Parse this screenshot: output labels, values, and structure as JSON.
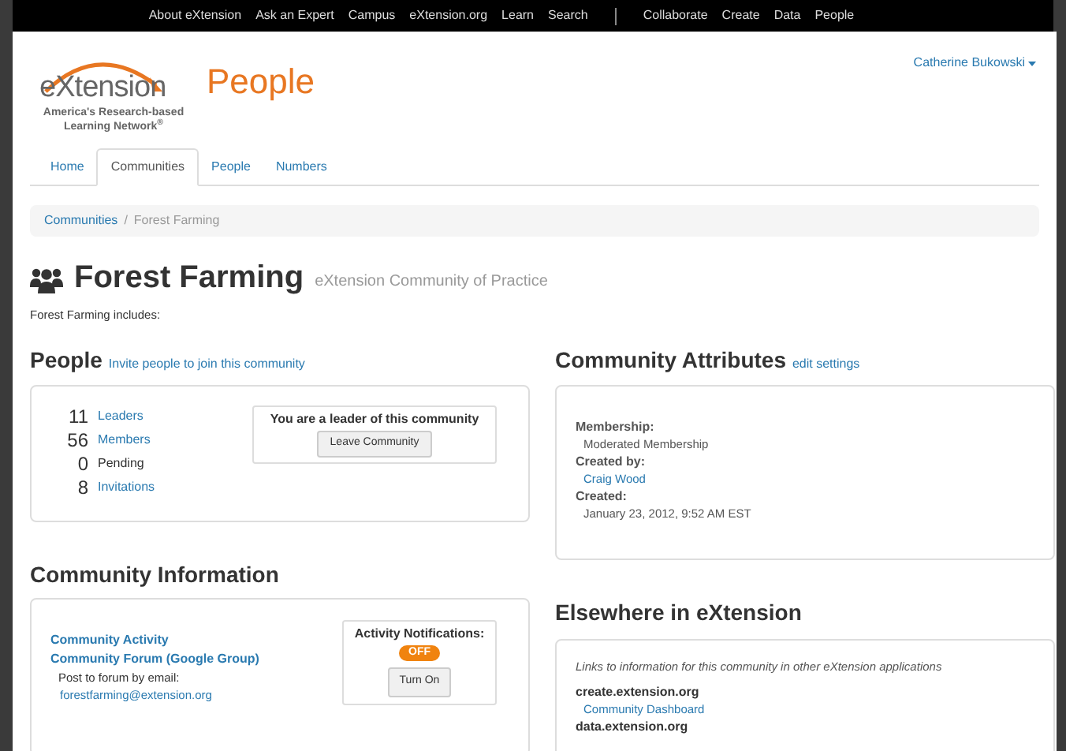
{
  "top_nav": {
    "links": [
      "About eXtension",
      "Ask an Expert",
      "Campus",
      "eXtension.org",
      "Learn",
      "Search"
    ],
    "apps": [
      "Collaborate",
      "Create",
      "Data",
      "People"
    ]
  },
  "logo": {
    "wordmark": "eXtension",
    "tagline": [
      "America's Research-based",
      "Learning Network$^{®}$"
    ],
    "app_name": "People"
  },
  "user_menu": {
    "label": "Catherine Bukowski"
  },
  "tabs": [
    {
      "label": "Home",
      "selected": false
    },
    {
      "label": "Communities",
      "selected": true
    },
    {
      "label": "People",
      "selected": false
    },
    {
      "label": "Numbers",
      "selected": false
    }
  ],
  "breadcrumb": [
    {
      "label": "Communities",
      "link": true
    },
    {
      "separator": "/",
      "label": "Forest Farming",
      "link": false
    }
  ],
  "page": {
    "title": "Forest Farming",
    "subtitle": "eXtension Community of Practice",
    "intro": "Forest Farming includes:"
  },
  "people": {
    "heading": "People",
    "action": "Invite people to join this community",
    "counts": [
      {
        "count": "11",
        "label": "Leaders",
        "link": true
      },
      {
        "count": "56",
        "label": "Members",
        "link": true
      },
      {
        "count": "0",
        "label": "Pending",
        "link": false
      },
      {
        "count": "8",
        "label": "Invitations",
        "link": true
      }
    ],
    "membership_box": {
      "message": "You are a leader of this community",
      "button": "Leave Community"
    }
  },
  "community_information": {
    "heading": "Community Information",
    "links": [
      "Community Activity",
      "Community Forum (Google Group)"
    ],
    "email_label": "Post to forum by email:",
    "email": "forestfarming@extension.org",
    "notifications": {
      "label": "Activity Notifications:",
      "badge": "OFF",
      "on": false,
      "button": "Turn On"
    }
  },
  "community_attributes": {
    "heading": "Community Attributes",
    "action": "edit settings",
    "fields": [
      {
        "label": "Membership:",
        "value": "Moderated Membership",
        "link": false
      },
      {
        "label": "Created by:",
        "value": "Craig Wood",
        "link": true
      },
      {
        "label": "Created:",
        "value": "January 23, 2012, 9:52 AM EST",
        "link": false
      }
    ]
  },
  "elsewhere": {
    "heading": "Elsewhere in eXtension",
    "note": "Links to information for this community in other eXtension applications",
    "sites": [
      {
        "name": "create.extension.org",
        "links": [
          "Community Dashboard"
        ]
      },
      {
        "name": "data.extension.org"
      }
    ]
  }
}
